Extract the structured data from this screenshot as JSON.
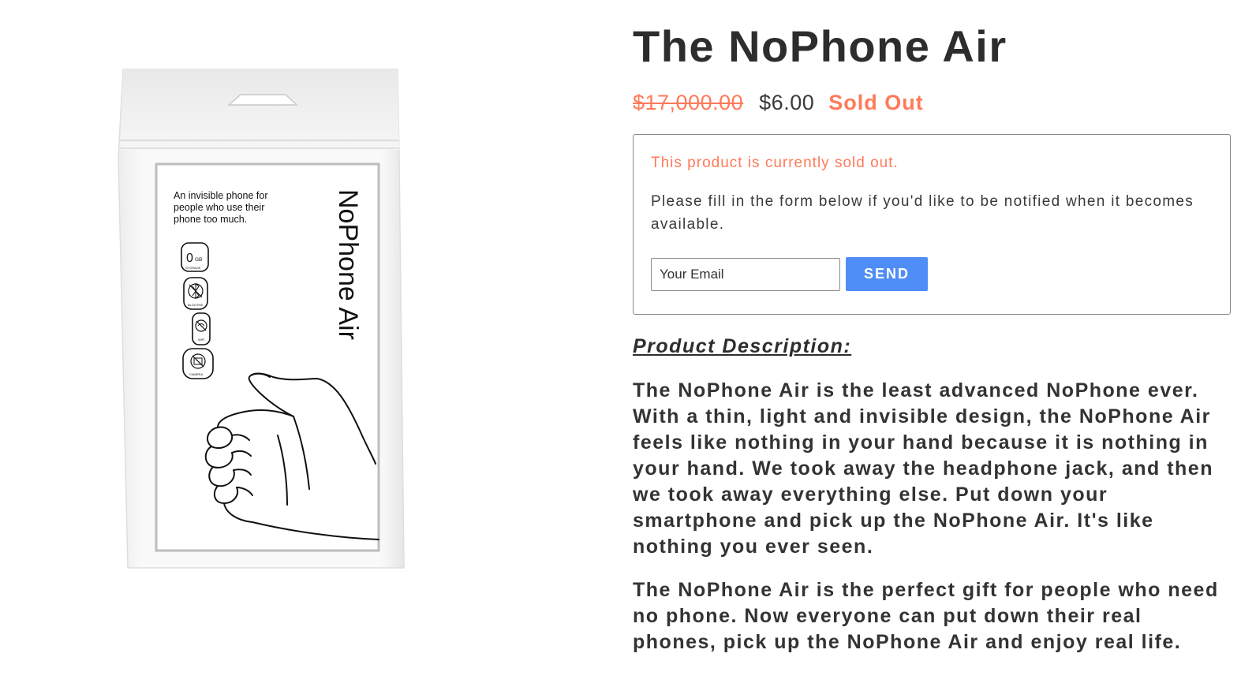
{
  "product": {
    "title": "The NoPhone Air",
    "price_original": "$17,000.00",
    "price_current": "$6.00",
    "status": "Sold Out"
  },
  "package": {
    "tagline_lines": [
      "An invisible phone for",
      "people who use their",
      "phone too much."
    ],
    "brand_text": "NoPhone Air",
    "features": [
      {
        "icon": "zero-storage-icon",
        "label": "STORAGE",
        "value": "0",
        "unit": "GB"
      },
      {
        "icon": "no-bluetooth-icon",
        "label": "BLOOTHE"
      },
      {
        "icon": "no-wifi-icon",
        "label": "WIFI"
      },
      {
        "icon": "no-camera-icon",
        "label": "CAMERA"
      }
    ]
  },
  "notify": {
    "message": "This product is currently sold out.",
    "instructions": "Please fill in the form below if you'd like to be notified when it becomes available.",
    "email_placeholder": "Your Email",
    "send_label": "SEND"
  },
  "description": {
    "heading": "Product Description:",
    "paragraphs": [
      "The NoPhone Air is the least advanced NoPhone ever. With a thin, light and invisible design, the NoPhone Air feels like nothing in your hand because it is nothing in your hand. We took away the headphone jack, and then we took away everything else. Put down your smartphone and pick up the NoPhone Air. It's like nothing you ever seen.",
      "The NoPhone Air is the perfect gift for people who need no phone. Now everyone can put down their real phones, pick up the NoPhone Air and enjoy real life."
    ]
  },
  "colors": {
    "accent": "#ff7a59",
    "button": "#4f8ef7",
    "text": "#333333"
  }
}
